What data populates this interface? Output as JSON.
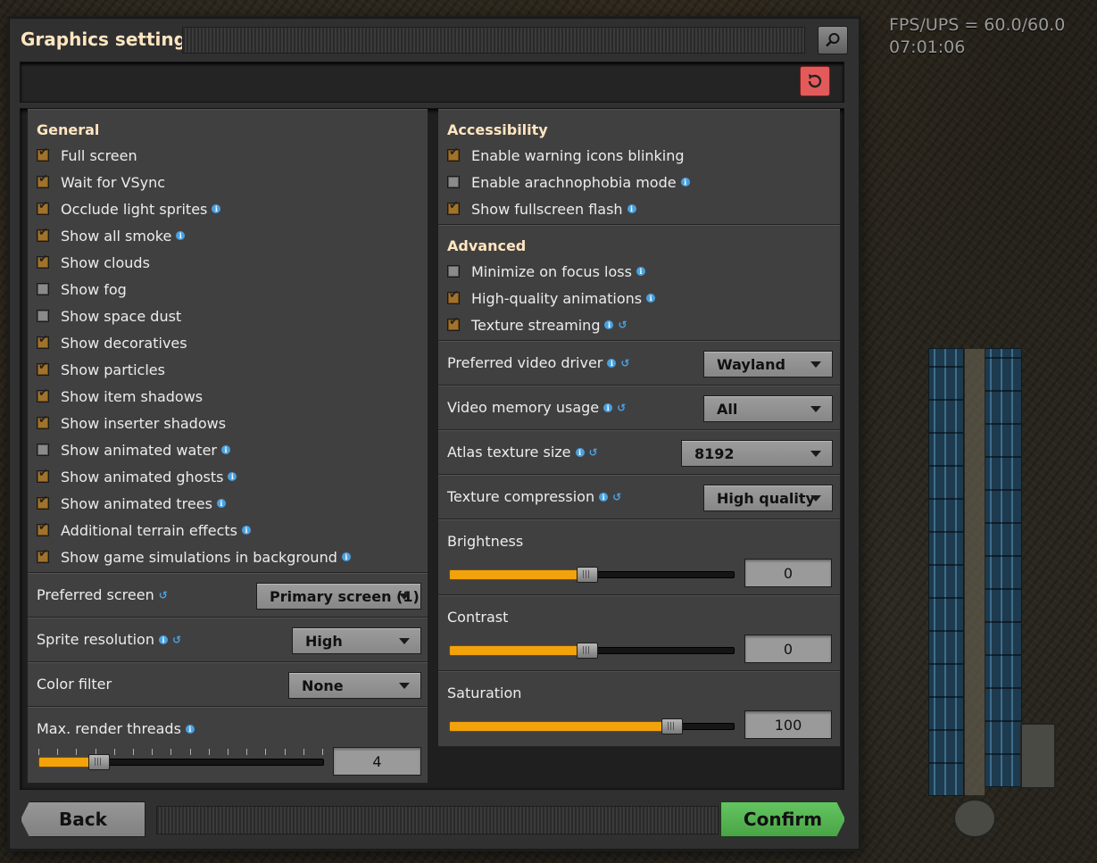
{
  "hud": {
    "fps": "FPS/UPS = 60.0/60.0",
    "time": "07:01:06"
  },
  "window": {
    "title": "Graphics settings"
  },
  "general": {
    "heading": "General",
    "items": [
      {
        "label": "Full screen",
        "checked": true,
        "info": false
      },
      {
        "label": "Wait for VSync",
        "checked": true,
        "info": false
      },
      {
        "label": "Occlude light sprites",
        "checked": true,
        "info": true
      },
      {
        "label": "Show all smoke",
        "checked": true,
        "info": true
      },
      {
        "label": "Show clouds",
        "checked": true,
        "info": false
      },
      {
        "label": "Show fog",
        "checked": false,
        "info": false
      },
      {
        "label": "Show space dust",
        "checked": false,
        "info": false
      },
      {
        "label": "Show decoratives",
        "checked": true,
        "info": false
      },
      {
        "label": "Show particles",
        "checked": true,
        "info": false
      },
      {
        "label": "Show item shadows",
        "checked": true,
        "info": false
      },
      {
        "label": "Show inserter shadows",
        "checked": true,
        "info": false
      },
      {
        "label": "Show animated water",
        "checked": false,
        "info": true
      },
      {
        "label": "Show animated ghosts",
        "checked": true,
        "info": true
      },
      {
        "label": "Show animated trees",
        "checked": true,
        "info": true
      },
      {
        "label": "Additional terrain effects",
        "checked": true,
        "info": true
      },
      {
        "label": "Show game simulations in background",
        "checked": true,
        "info": true
      }
    ]
  },
  "preferred_screen": {
    "label": "Preferred screen",
    "value": "Primary screen (1)"
  },
  "sprite_resolution": {
    "label": "Sprite resolution",
    "value": "High"
  },
  "color_filter": {
    "label": "Color filter",
    "value": "None"
  },
  "render_threads": {
    "label": "Max. render threads",
    "value": "4",
    "fill": 0.19
  },
  "accessibility": {
    "heading": "Accessibility",
    "items": [
      {
        "label": "Enable warning icons blinking",
        "checked": true,
        "info": false
      },
      {
        "label": "Enable arachnophobia mode",
        "checked": false,
        "info": true
      },
      {
        "label": "Show fullscreen flash",
        "checked": true,
        "info": true
      }
    ]
  },
  "advanced": {
    "heading": "Advanced",
    "items": [
      {
        "label": "Minimize on focus loss",
        "checked": false,
        "info": true,
        "restart": false
      },
      {
        "label": "High-quality animations",
        "checked": true,
        "info": true,
        "restart": false
      },
      {
        "label": "Texture streaming",
        "checked": true,
        "info": true,
        "restart": true
      }
    ]
  },
  "video_driver": {
    "label": "Preferred video driver",
    "value": "Wayland"
  },
  "video_memory": {
    "label": "Video memory usage",
    "value": "All"
  },
  "atlas_size": {
    "label": "Atlas texture size",
    "value": "8192"
  },
  "texture_compression": {
    "label": "Texture compression",
    "value": "High quality"
  },
  "brightness": {
    "label": "Brightness",
    "value": "0",
    "fill": 0.5
  },
  "contrast": {
    "label": "Contrast",
    "value": "0",
    "fill": 0.5
  },
  "saturation": {
    "label": "Saturation",
    "value": "100",
    "fill": 0.8
  },
  "buttons": {
    "back": "Back",
    "confirm": "Confirm"
  },
  "colors": {
    "accent_orange": "#f2a20a",
    "heading": "#ffe6c0",
    "confirm_green": "#5cbf59",
    "reset_red": "#e35a5a",
    "info_blue": "#4aa1e0"
  },
  "icons": {
    "search": "search-icon",
    "reset": "reset-icon",
    "info": "info-icon",
    "restart": "restart-required-icon"
  }
}
